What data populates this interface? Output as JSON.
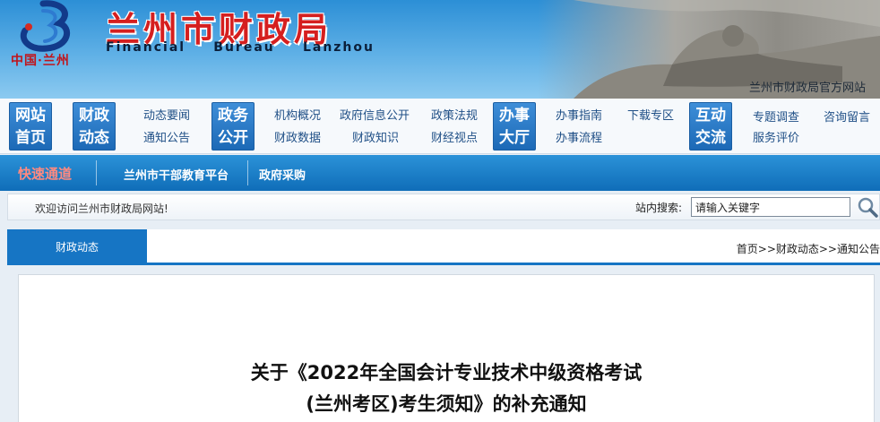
{
  "header": {
    "logo_caption": "中国·兰州",
    "site_title": "兰州市财政局",
    "en_title": [
      "Financial",
      "Bureau",
      "Lanzhou"
    ],
    "official_site": "兰州市财政局官方网站"
  },
  "nav": {
    "blocks": [
      "网站首页",
      "财政动态",
      "政务公开",
      "办事大厅",
      "互动交流"
    ],
    "links": {
      "news": "动态要闻",
      "notice": "通知公告",
      "org": "机构概况",
      "finance_data": "财政数据",
      "gov_info": "政府信息公开",
      "finance_knowledge": "财政知识",
      "policy": "政策法规",
      "finance_view": "财经视点",
      "guide": "办事指南",
      "process": "办事流程",
      "download": "下载专区",
      "survey": "专题调查",
      "service_eval": "服务评价",
      "consult": "咨询留言"
    }
  },
  "quick": {
    "label": "快速通道",
    "links": [
      "兰州市干部教育平台",
      "政府采购"
    ]
  },
  "search": {
    "welcome": "欢迎访问兰州市财政局网站!",
    "label": "站内搜索:",
    "value": "请输入关键字"
  },
  "section": {
    "tab": "财政动态",
    "breadcrumb": "首页>>财政动态>>通知公告"
  },
  "article": {
    "title_line1": "关于《2022年全国会计专业技术中级资格考试",
    "title_line2": "(兰州考区)考生须知》的补充通知"
  },
  "colors": {
    "accent": "#1675c4",
    "brand_red": "#d51f1f"
  }
}
